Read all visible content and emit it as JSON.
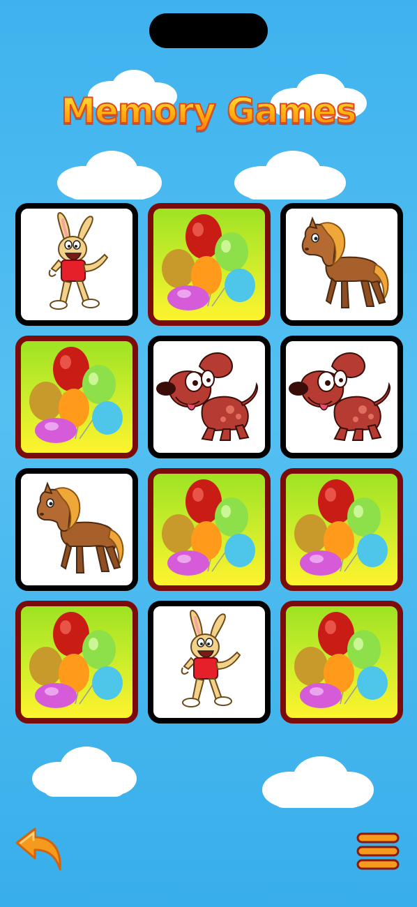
{
  "app": {
    "title": "Memory Games"
  },
  "colors": {
    "sky": "#45b6ef",
    "title_fill": "#ffd21a",
    "title_stroke": "#e0471b",
    "face_border": "#000000",
    "back_border": "#7c0b0b",
    "back_gradient_top": "#9ee323",
    "back_gradient_bottom": "#fff32e",
    "control_orange": "#f59a1c"
  },
  "board": {
    "rows": 4,
    "cols": 3,
    "cards": [
      {
        "state": "face_up",
        "image": "rabbit"
      },
      {
        "state": "face_down",
        "image": "balloons"
      },
      {
        "state": "face_up",
        "image": "horse"
      },
      {
        "state": "face_down",
        "image": "balloons"
      },
      {
        "state": "face_up",
        "image": "dog"
      },
      {
        "state": "face_up",
        "image": "dog"
      },
      {
        "state": "face_up",
        "image": "horse"
      },
      {
        "state": "face_down",
        "image": "balloons"
      },
      {
        "state": "face_down",
        "image": "balloons"
      },
      {
        "state": "face_down",
        "image": "balloons"
      },
      {
        "state": "face_up",
        "image": "rabbit"
      },
      {
        "state": "face_down",
        "image": "balloons"
      }
    ]
  },
  "controls": {
    "back_icon": "curved-back-arrow-icon",
    "menu_icon": "hamburger-menu-icon"
  }
}
